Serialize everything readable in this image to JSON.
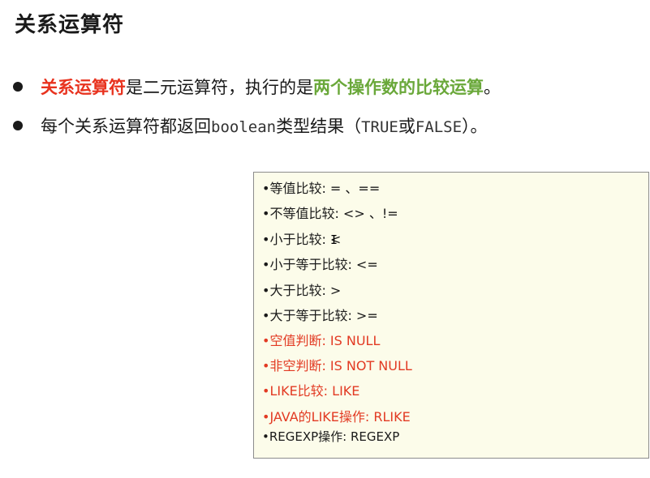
{
  "title": "关系运算符",
  "bullet1": {
    "part1": "关系运算符",
    "part2": "是二元运算符，执行的是",
    "part3": "两个操作数的比较运算",
    "part4": "。"
  },
  "bullet2": {
    "part1": "每个关系运算符都返回",
    "part2": "boolean",
    "part3": "类型结果（",
    "part4": "TRUE",
    "part5": "或",
    "part6": "FALSE",
    "part7": "）。"
  },
  "note": {
    "items": [
      "•等值比较: = 、==",
      "•不等值比较: <> 、!=",
      "•小于比较: <",
      "•小于等于比较: <=",
      "•大于比较: >",
      "•大于等于比较: >=",
      "•空值判断: IS NULL",
      "•非空判断: IS NOT NULL",
      "•LIKE比较: LIKE",
      "•JAVA的LIKE操作: RLIKE",
      "•REGEXP操作: REGEXP"
    ]
  },
  "colors": {
    "red": "#e8321e",
    "green": "#6aa83a",
    "note_bg": "#fcfcea"
  }
}
